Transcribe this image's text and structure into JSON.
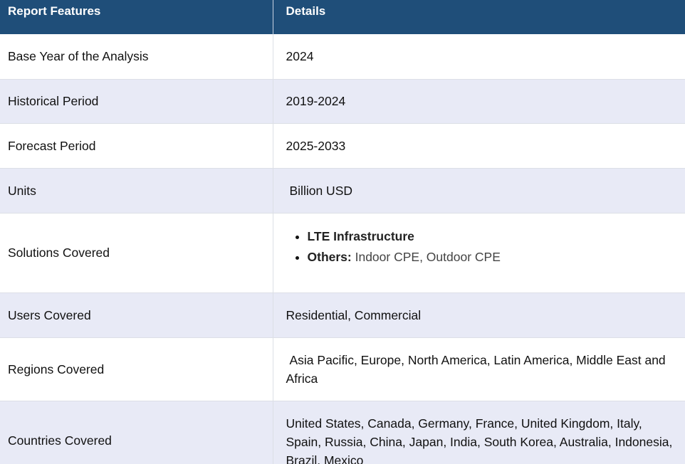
{
  "header": {
    "col1": "Report Features",
    "col2": "Details"
  },
  "rows": [
    {
      "feature": "Base Year of the Analysis",
      "detail": "2024"
    },
    {
      "feature": "Historical Period",
      "detail": "2019-2024"
    },
    {
      "feature": "Forecast Period",
      "detail": "2025-2033"
    },
    {
      "feature": "Units",
      "detail": "Billion USD"
    },
    {
      "feature": "Solutions Covered",
      "bullets": [
        {
          "bold": "LTE Infrastructure",
          "rest": ""
        },
        {
          "bold": "Others:",
          "rest": "Indoor CPE, Outdoor CPE"
        }
      ]
    },
    {
      "feature": "Users Covered",
      "detail": "Residential, Commercial"
    },
    {
      "feature": "Regions Covered",
      "detail": "Asia Pacific, Europe, North America, Latin America, Middle East and Africa"
    },
    {
      "feature": "Countries Covered",
      "detail": "United States, Canada, Germany, France, United Kingdom, Italy, Spain, Russia, China, Japan, India, South Korea, Australia, Indonesia, Brazil, Mexico"
    }
  ]
}
